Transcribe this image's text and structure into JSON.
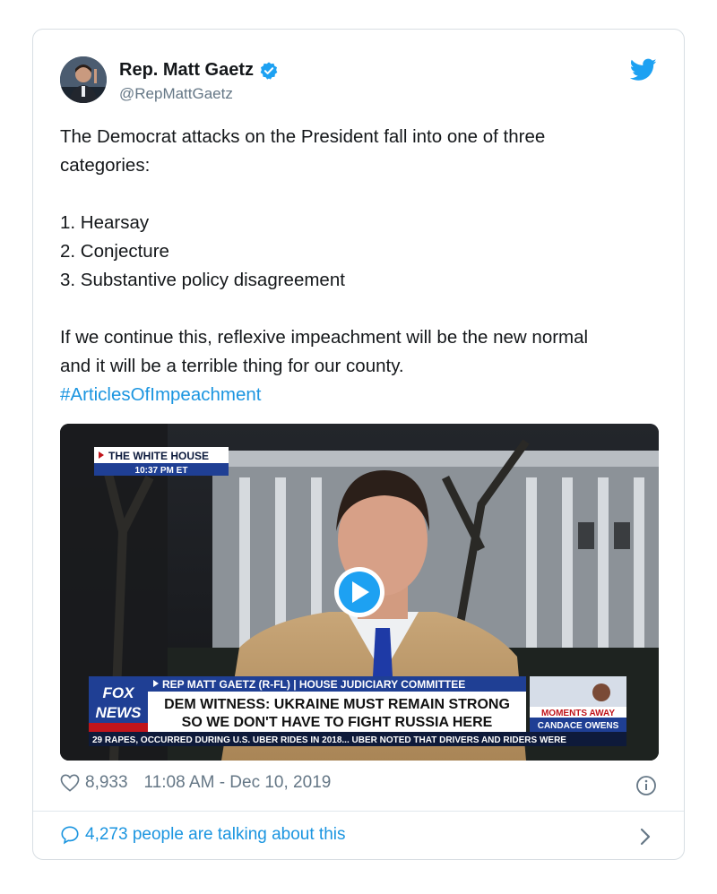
{
  "author": {
    "name": "Rep. Matt Gaetz",
    "handle": "@RepMattGaetz",
    "verified": true
  },
  "tweet": {
    "line1": "The Democrat attacks on the President fall into one of three",
    "line2": "categories:",
    "items": [
      "1. Hearsay",
      "2. Conjecture",
      "3. Substantive policy disagreement"
    ],
    "line3": "If we continue this, reflexive impeachment will be the new normal",
    "line4": "and it will be a terrible thing for our county.",
    "hashtag": "#ArticlesOfImpeachment"
  },
  "video": {
    "location_label": "THE WHITE HOUSE",
    "time_label": "10:37 PM ET",
    "network_logo_top": "FOX",
    "network_logo_bottom": "NEWS",
    "lower_third_top": "REP MATT GAETZ (R-FL) | HOUSE JUDICIARY COMMITTEE",
    "headline_line1": "DEM WITNESS: UKRAINE MUST REMAIN STRONG",
    "headline_line2": "SO WE DON'T HAVE TO FIGHT RUSSIA HERE",
    "promo_line1": "MOMENTS AWAY",
    "promo_line2": "CANDACE OWENS",
    "ticker": "29 RAPES, OCCURRED DURING U.S. UBER RIDES IN 2018...   UBER NOTED THAT DRIVERS AND RIDERS WERE"
  },
  "footer": {
    "likes": "8,933",
    "timestamp": "11:08 AM - Dec 10, 2019",
    "talking": "4,273 people are talking about this"
  },
  "colors": {
    "link": "#1b95e0",
    "text": "#14171a",
    "muted": "#657786",
    "fox_blue": "#1f3f94"
  }
}
